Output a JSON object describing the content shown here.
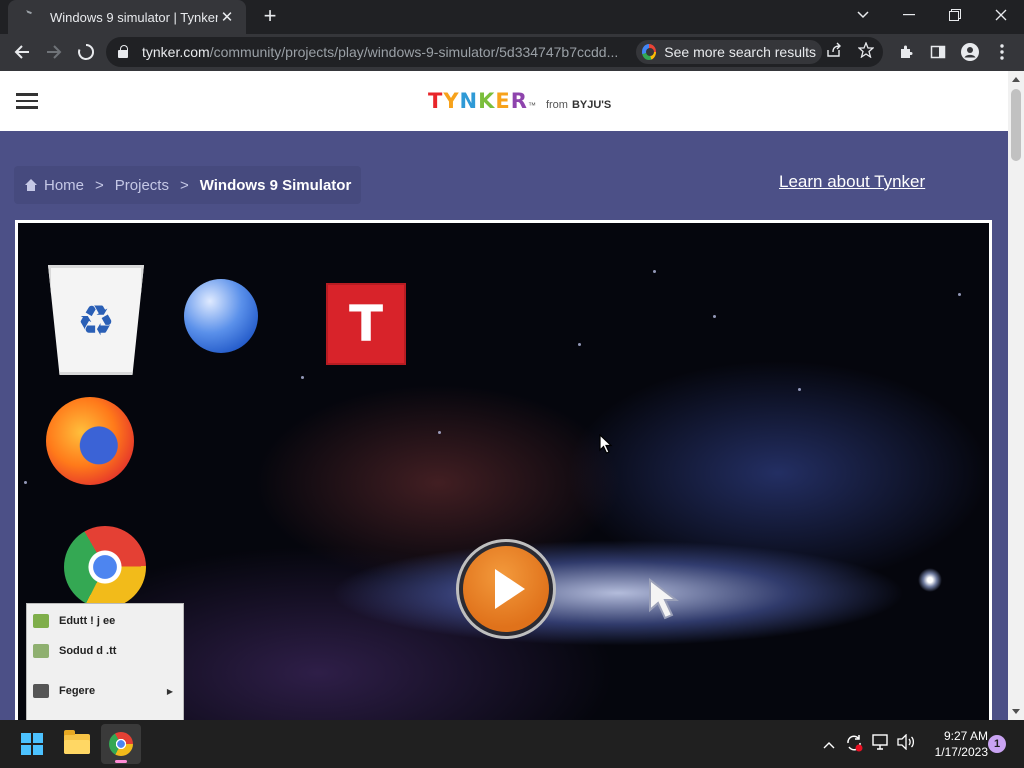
{
  "browser": {
    "tab_title": "Windows 9 simulator | Tynker",
    "tab_close": "✕",
    "new_tab": "+",
    "url_host": "tynker.com",
    "url_path": "/community/projects/play/windows-9-simulator/5d334747b7ccdd...",
    "search_chip": "See more search results",
    "window_controls": {
      "minimize": "—",
      "restore": "❐",
      "close": "✕",
      "tab_search": "⌄"
    }
  },
  "site": {
    "logo_letters": [
      "T",
      "Y",
      "N",
      "K",
      "E",
      "R"
    ],
    "logo_colors": [
      "#e8262a",
      "#f7a21b",
      "#2f9ad6",
      "#7bbe3c",
      "#f7a21b",
      "#8e44ad"
    ],
    "logo_trademark": "™",
    "logo_from": "from",
    "logo_byjus": "BYJU'S",
    "breadcrumb": {
      "home": "Home",
      "projects": "Projects",
      "current": "Windows 9 Simulator",
      "separator": ">"
    },
    "learn_link": "Learn about Tynker"
  },
  "stage": {
    "start_menu_items": [
      {
        "label": "Edutt ! j  ee"
      },
      {
        "label": "Sodud d  .tt"
      },
      {
        "label": "Fegere"
      }
    ]
  },
  "taskbar": {
    "time": "9:27 AM",
    "date": "1/17/2023",
    "notifications": "1"
  }
}
